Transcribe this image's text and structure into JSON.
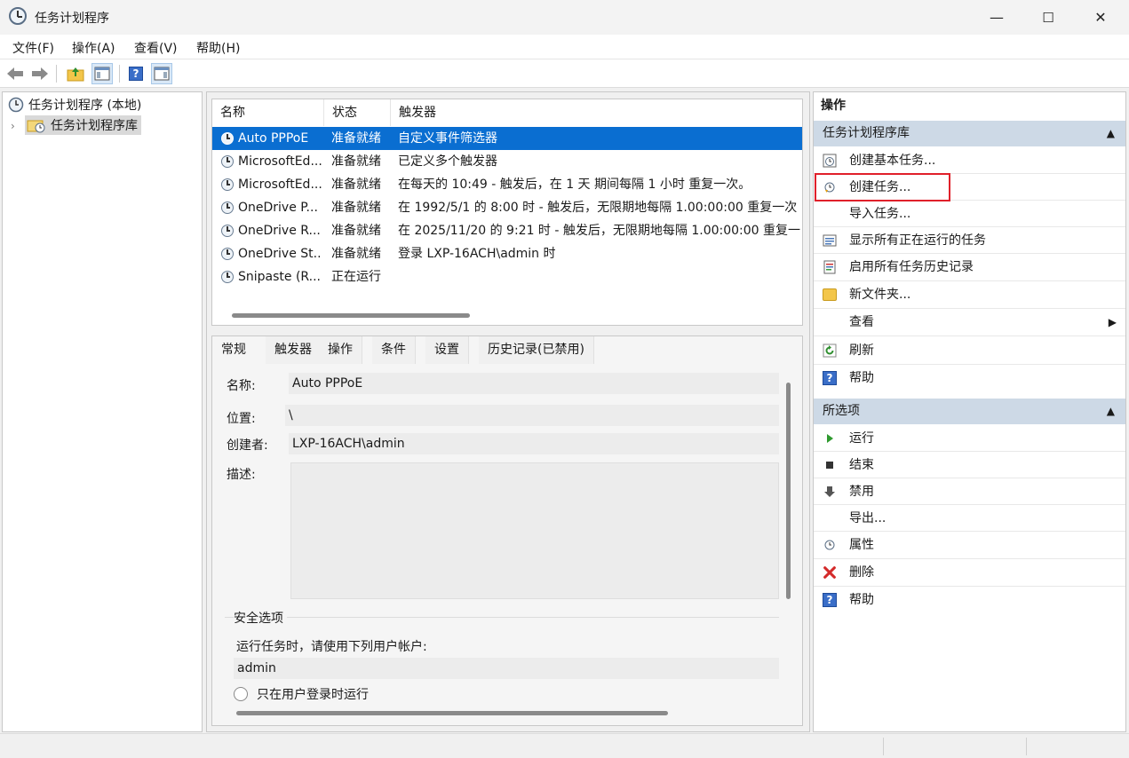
{
  "window": {
    "title": "任务计划程序",
    "minimize": "—",
    "maximize": "☐",
    "close": "✕"
  },
  "menu": [
    "文件(F)",
    "操作(A)",
    "查看(V)",
    "帮助(H)"
  ],
  "tree": {
    "root": "任务计划程序 (本地)",
    "library": "任务计划程序库",
    "expander": "›"
  },
  "list": {
    "columns": [
      "名称",
      "状态",
      "触发器"
    ],
    "rows": [
      {
        "name": "Auto PPPoE",
        "status": "准备就绪",
        "trigger": "自定义事件筛选器"
      },
      {
        "name": "MicrosoftEd...",
        "status": "准备就绪",
        "trigger": "已定义多个触发器"
      },
      {
        "name": "MicrosoftEd...",
        "status": "准备就绪",
        "trigger": "在每天的 10:49 - 触发后，在 1 天 期间每隔 1 小时 重复一次。"
      },
      {
        "name": "OneDrive P...",
        "status": "准备就绪",
        "trigger": "在 1992/5/1 的 8:00 时 - 触发后，无限期地每隔 1.00:00:00 重复一次"
      },
      {
        "name": "OneDrive R...",
        "status": "准备就绪",
        "trigger": "在 2025/11/20 的 9:21 时 - 触发后，无限期地每隔 1.00:00:00 重复一"
      },
      {
        "name": "OneDrive St...",
        "status": "准备就绪",
        "trigger": "登录 LXP-16ACH\\admin 时"
      },
      {
        "name": "Snipaste (R...",
        "status": "正在运行",
        "trigger": ""
      }
    ]
  },
  "detail": {
    "tabs": [
      "常规",
      "触发器",
      "操作",
      "条件",
      "设置",
      "历史记录(已禁用)"
    ],
    "name_label": "名称:",
    "name_value": "Auto PPPoE",
    "location_label": "位置:",
    "location_value": "\\",
    "author_label": "创建者:",
    "author_value": "LXP-16ACH\\admin",
    "desc_label": "描述:",
    "security_title": "安全选项",
    "run_as_text": "运行任务时，请使用下列用户帐户:",
    "user": "admin",
    "radio_label": "只在用户登录时运行"
  },
  "actions": {
    "header": "操作",
    "group1": "任务计划程序库",
    "group1_items": [
      "创建基本任务...",
      "创建任务...",
      "导入任务...",
      "显示所有正在运行的任务",
      "启用所有任务历史记录",
      "新文件夹...",
      "查看",
      "刷新",
      "帮助"
    ],
    "group2": "所选项",
    "group2_items": [
      "运行",
      "结束",
      "禁用",
      "导出...",
      "属性",
      "删除",
      "帮助"
    ],
    "collapse_caret": "▲",
    "submenu_caret": "▶"
  }
}
